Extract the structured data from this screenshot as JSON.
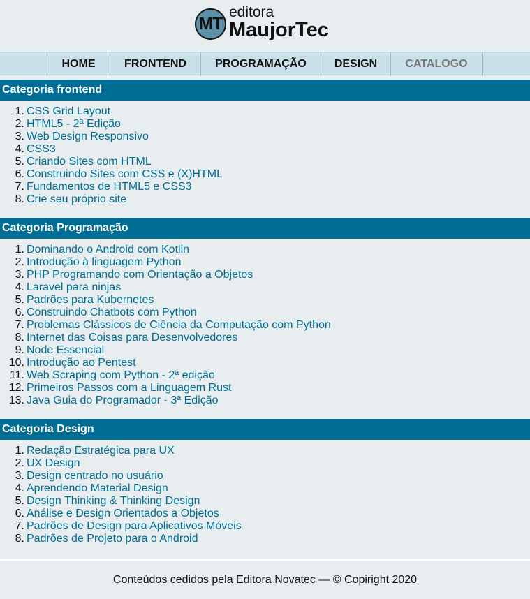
{
  "header": {
    "logo_badge": "MT",
    "logo_small": "editora",
    "logo_big": "MaujorTec"
  },
  "nav": {
    "items": [
      {
        "label": "HOME"
      },
      {
        "label": "FRONTEND"
      },
      {
        "label": "PROGRAMAÇÃO"
      },
      {
        "label": "DESIGN"
      },
      {
        "label": "CATALOGO",
        "active": true
      }
    ]
  },
  "categories": [
    {
      "title": "Categoria frontend",
      "books": [
        "CSS Grid Layout",
        "HTML5 - 2ª Edição",
        "Web Design Responsivo",
        "CSS3",
        "Criando Sites com HTML",
        "Construindo Sites com CSS e (X)HTML",
        "Fundamentos de HTML5 e CSS3",
        "Crie seu próprio site"
      ]
    },
    {
      "title": "Categoria Programação",
      "books": [
        "Dominando o Android com Kotlin",
        "Introdução à linguagem Python",
        "PHP Programando com Orientação a Objetos",
        "Laravel para ninjas",
        "Padrões para Kubernetes",
        "Construindo Chatbots com Python",
        "Problemas Clássicos de Ciência da Computação com Python",
        "Internet das Coisas para Desenvolvedores",
        "Node Essencial",
        "Introdução ao Pentest",
        "Web Scraping com Python - 2ª edição",
        "Primeiros Passos com a Linguagem Rust",
        "Java Guia do Programador - 3ª Edição"
      ]
    },
    {
      "title": "Categoria Design",
      "books": [
        "Redação Estratégica para UX",
        "UX Design",
        "Design centrado no usuário",
        "Aprendendo Material Design",
        "Design Thinking & Thinking Design",
        "Análise e Design Orientados a Objetos",
        "Padrões de Design para Aplicativos Móveis",
        "Padrões de Projeto para o Android"
      ]
    }
  ],
  "footer": {
    "text": "Conteúdos cedidos pela Editora Novatec — © Copiright 2020"
  },
  "colors": {
    "category_bar": "#006e94",
    "link": "#006e94",
    "nav_bg": "#c9e0e8",
    "page_bg": "#e8eef0"
  }
}
